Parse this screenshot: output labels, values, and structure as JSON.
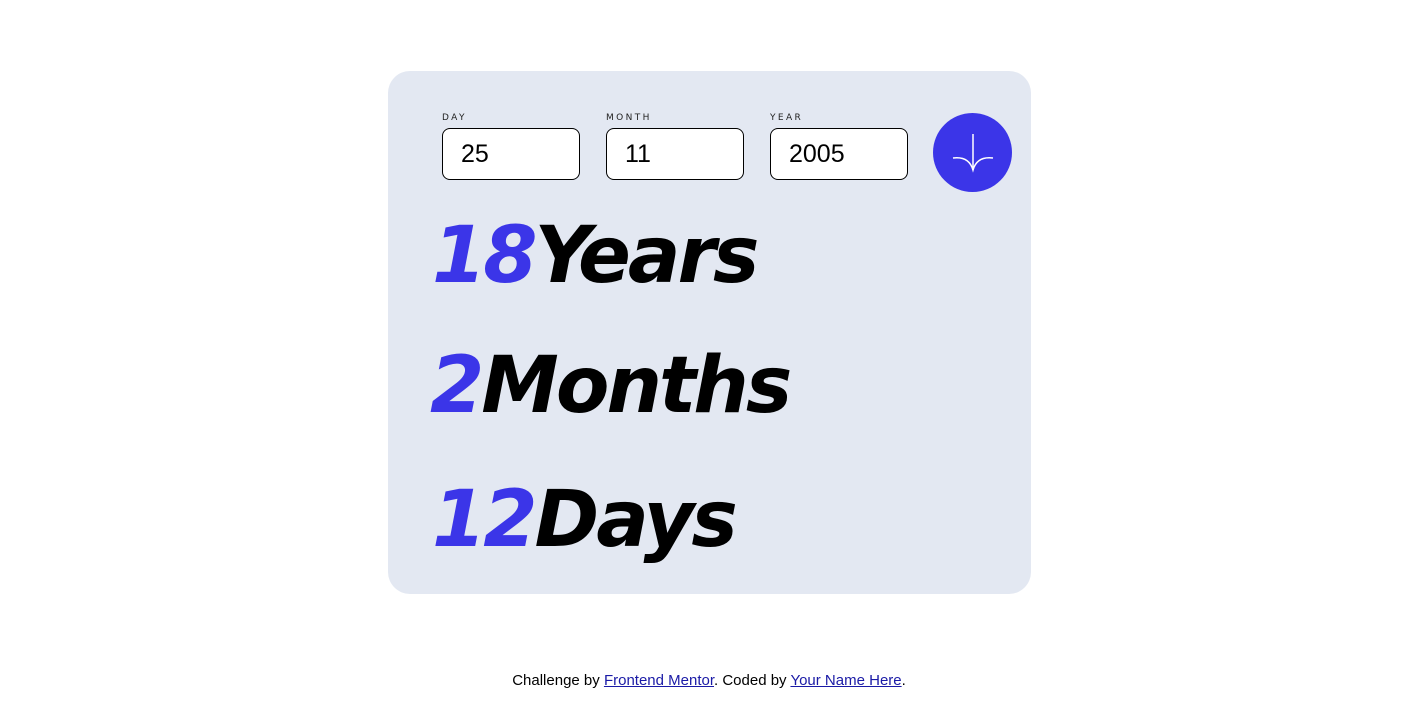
{
  "form": {
    "day": {
      "label": "DAY",
      "value": "25"
    },
    "month": {
      "label": "MONTH",
      "value": "11"
    },
    "year": {
      "label": "YEAR",
      "value": "2005"
    },
    "submit_icon": "arrow-down-icon"
  },
  "results": {
    "years": {
      "value": "18",
      "unit": "Years"
    },
    "months": {
      "value": "2",
      "unit": "Months"
    },
    "days": {
      "value": "12",
      "unit": "Days"
    }
  },
  "footer": {
    "prefix": "Challenge by ",
    "link1": "Frontend Mentor",
    "middle": ". Coded by ",
    "link2": "Your Name Here",
    "suffix": "."
  },
  "colors": {
    "accent": "#3b35e8",
    "card_bg": "#e3e8f2",
    "page_bg": "#ffffff"
  }
}
